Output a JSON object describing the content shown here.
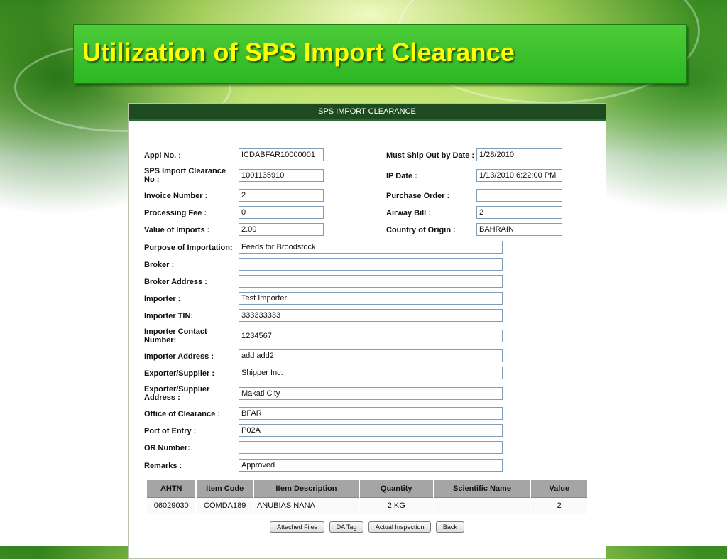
{
  "slide": {
    "title": "Utilization of SPS Import Clearance"
  },
  "form": {
    "header": "SPS IMPORT CLEARANCE",
    "left_fields": [
      {
        "label": "Appl No. :",
        "value": "ICDABFAR10000001"
      },
      {
        "label": "SPS Import Clearance No :",
        "value": "1001135910"
      },
      {
        "label": "Invoice Number :",
        "value": "2"
      },
      {
        "label": "Processing Fee :",
        "value": "0"
      },
      {
        "label": "Value of Imports :",
        "value": "2.00"
      }
    ],
    "right_fields": [
      {
        "label": "Must Ship Out by Date :",
        "value": "1/28/2010"
      },
      {
        "label": "IP Date :",
        "value": "1/13/2010 6:22:00 PM"
      },
      {
        "label": "Purchase Order :",
        "value": ""
      },
      {
        "label": "Airway Bill :",
        "value": "2"
      },
      {
        "label": "Country of Origin :",
        "value": "BAHRAIN"
      }
    ],
    "long_fields": [
      {
        "label": "Purpose of Importation:",
        "value": "Feeds for Broodstock"
      },
      {
        "label": "Broker :",
        "value": ""
      },
      {
        "label": "Broker Address :",
        "value": ""
      },
      {
        "label": "Importer :",
        "value": "Test Importer"
      },
      {
        "label": "Importer TIN:",
        "value": "333333333"
      },
      {
        "label": "Importer Contact Number:",
        "value": "1234567"
      },
      {
        "label": "Importer Address :",
        "value": "add add2"
      },
      {
        "label": "Exporter/Supplier :",
        "value": "Shipper Inc."
      },
      {
        "label": "Exporter/Supplier Address :",
        "value": "Makati City"
      },
      {
        "label": "Office of Clearance :",
        "value": "BFAR"
      },
      {
        "label": "Port of Entry :",
        "value": "P02A"
      },
      {
        "label": "OR Number:",
        "value": ""
      },
      {
        "label": "Remarks :",
        "value": "Approved"
      }
    ]
  },
  "items_table": {
    "headers": [
      "AHTN",
      "Item Code",
      "Item Description",
      "Quantity",
      "Scientific Name",
      "Value"
    ],
    "rows": [
      [
        "06029030",
        "COMDA189",
        "ANUBIAS NANA",
        "2  KG",
        "",
        "2"
      ]
    ]
  },
  "buttons": {
    "attached_files": "Attached Files",
    "da_tag": "DA Tag",
    "actual_inspection": "Actual Inspection",
    "back": "Back"
  },
  "colors": {
    "title_bar": "#3cc22e",
    "title_text": "#ffff00",
    "form_header": "#1e4a22",
    "table_header": "#a5a5a5"
  }
}
